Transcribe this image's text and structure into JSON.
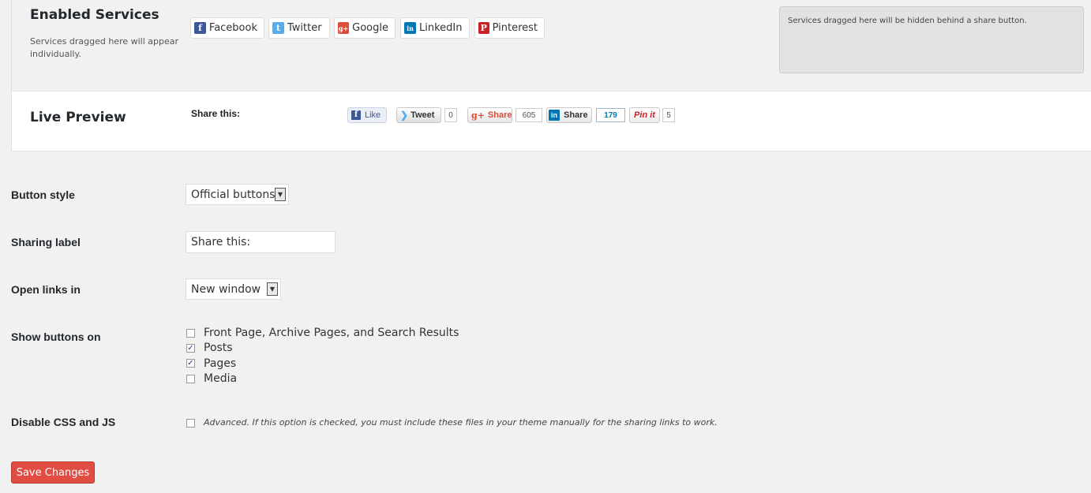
{
  "enabled": {
    "title": "Enabled Services",
    "description": "Services dragged here will appear individually.",
    "services": [
      {
        "label": "Facebook",
        "icon": "facebook-icon",
        "glyph": "f",
        "color": "#3b5998"
      },
      {
        "label": "Twitter",
        "icon": "twitter-icon",
        "glyph": "t",
        "color": "#55acee"
      },
      {
        "label": "Google",
        "icon": "google-plus-icon",
        "glyph": "g+",
        "color": "#dd4b39"
      },
      {
        "label": "LinkedIn",
        "icon": "linkedin-icon",
        "glyph": "in",
        "color": "#0077b5"
      },
      {
        "label": "Pinterest",
        "icon": "pinterest-icon",
        "glyph": "P",
        "color": "#cb2027"
      }
    ],
    "hidden_zone_text": "Services dragged here will be hidden behind a share button."
  },
  "preview": {
    "title": "Live Preview",
    "share_label": "Share this:",
    "fb_like": "Like",
    "tweet": "Tweet",
    "tweet_count": "0",
    "gplus_share": "Share",
    "gplus_count": "605",
    "linkedin_share": "Share",
    "linkedin_count": "179",
    "pinit": "Pin it",
    "pin_count": "5"
  },
  "form": {
    "button_style_label": "Button style",
    "button_style_value": "Official buttons",
    "sharing_label_label": "Sharing label",
    "sharing_label_value": "Share this:",
    "open_links_label": "Open links in",
    "open_links_value": "New window",
    "show_buttons_label": "Show buttons on",
    "show_options": [
      {
        "label": "Front Page, Archive Pages, and Search Results",
        "checked": false
      },
      {
        "label": "Posts",
        "checked": true
      },
      {
        "label": "Pages",
        "checked": true
      },
      {
        "label": "Media",
        "checked": false
      }
    ],
    "disable_css_label": "Disable CSS and JS",
    "disable_css_note": "Advanced. If this option is checked, you must include these files in your theme manually for the sharing links to work.",
    "save_label": "Save Changes"
  },
  "colors": {
    "save": "#e14d43",
    "accent": "#1e3c8c"
  }
}
